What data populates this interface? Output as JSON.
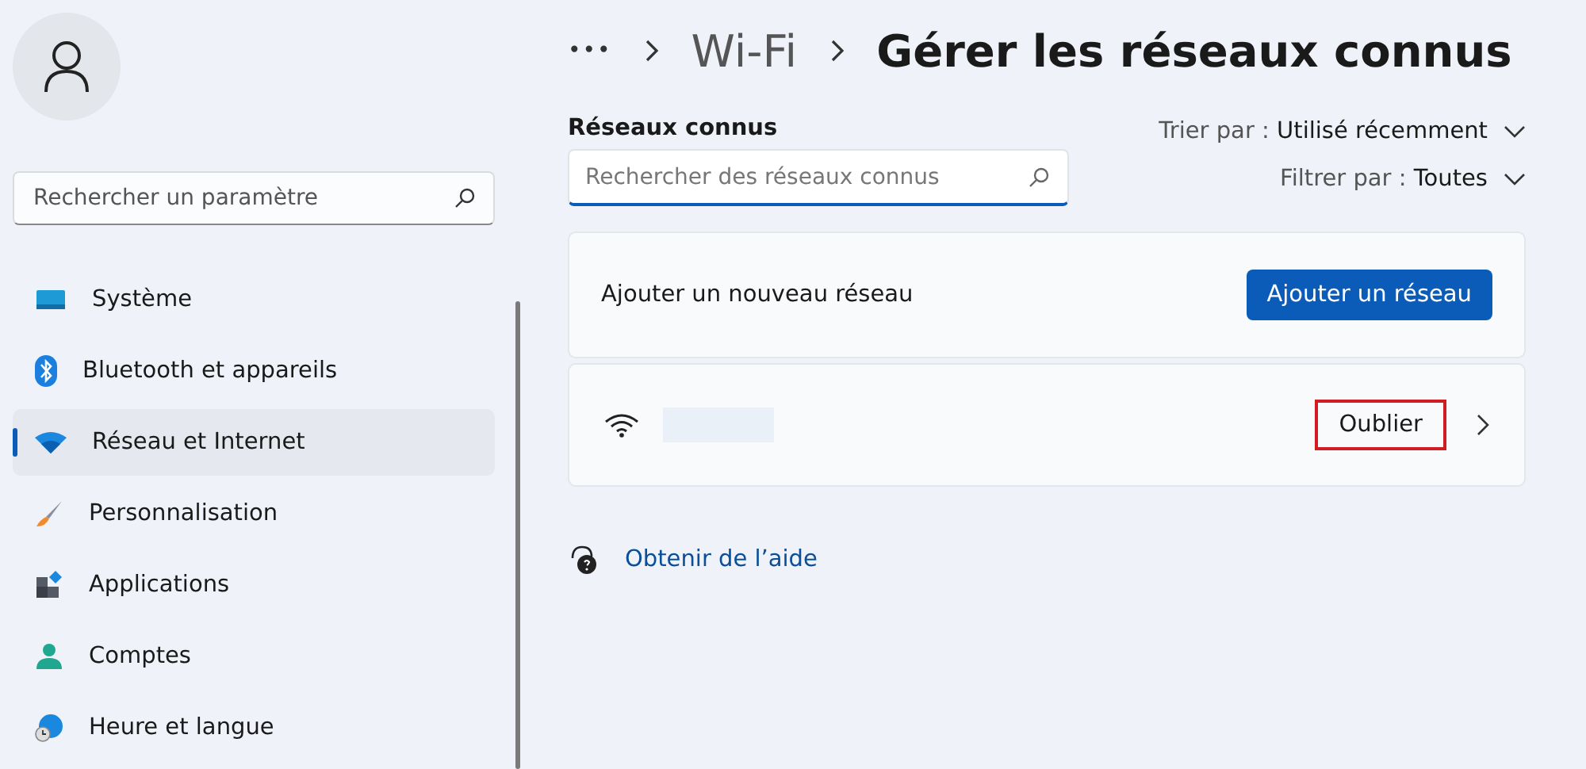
{
  "sidebar": {
    "search": {
      "placeholder": "Rechercher un paramètre"
    },
    "items": [
      {
        "label": "Système",
        "kind": "system",
        "selected": false
      },
      {
        "label": "Bluetooth et appareils",
        "kind": "bluetooth",
        "selected": false
      },
      {
        "label": "Réseau et Internet",
        "kind": "network",
        "selected": true
      },
      {
        "label": "Personnalisation",
        "kind": "brush",
        "selected": false
      },
      {
        "label": "Applications",
        "kind": "apps",
        "selected": false
      },
      {
        "label": "Comptes",
        "kind": "accounts",
        "selected": false
      },
      {
        "label": "Heure et langue",
        "kind": "time",
        "selected": false
      }
    ]
  },
  "breadcrumb": {
    "more": "•••",
    "items": [
      "Wi-Fi",
      "Gérer les réseaux connus"
    ]
  },
  "known_networks": {
    "heading": "Réseaux connus",
    "search": {
      "placeholder": "Rechercher des réseaux connus"
    },
    "sort": {
      "label": "Trier par :",
      "value": "Utilisé récemment"
    },
    "filter": {
      "label": "Filtrer par :",
      "value": "Toutes"
    },
    "add": {
      "label": "Ajouter un nouveau réseau",
      "button": "Ajouter un réseau"
    },
    "networks": [
      {
        "name_redacted": true,
        "forget": "Oublier",
        "highlighted": true
      }
    ]
  },
  "help_link": "Obtenir de l’aide"
}
